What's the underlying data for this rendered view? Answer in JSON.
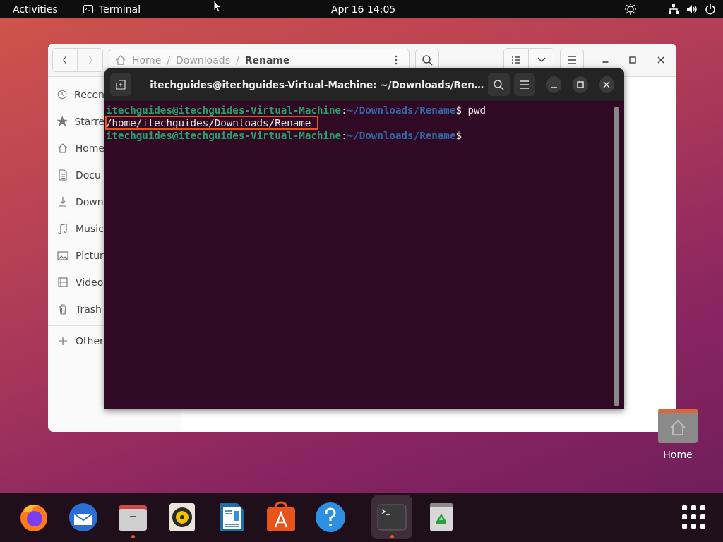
{
  "top_bar": {
    "activities": "Activities",
    "app_name": "Terminal",
    "clock": "Apr 16  14:05"
  },
  "files_window": {
    "path_bar": {
      "separator": "/",
      "items": [
        {
          "label": "Home",
          "current": false
        },
        {
          "label": "Downloads",
          "current": false
        },
        {
          "label": "Rename",
          "current": true
        }
      ]
    },
    "sidebar": {
      "items": [
        {
          "kind": "recent",
          "label": "Recen"
        },
        {
          "kind": "starred",
          "label": "Starre"
        },
        {
          "kind": "home",
          "label": "Home"
        },
        {
          "kind": "documents",
          "label": "Docu"
        },
        {
          "kind": "downloads",
          "label": "Down"
        },
        {
          "kind": "music",
          "label": "Music"
        },
        {
          "kind": "pictures",
          "label": "Pictur"
        },
        {
          "kind": "videos",
          "label": "Video"
        },
        {
          "kind": "trash",
          "label": "Trash"
        },
        {
          "kind": "other",
          "label": "Other"
        }
      ]
    }
  },
  "terminal_window": {
    "title": "itechguides@itechguides-Virtual-Machine: ~/Downloads/Ren…",
    "lines": [
      {
        "kind": "prompt",
        "user": "itechguides@itechguides-Virtual-Machine",
        "separator": ":",
        "path": "~/Downloads/Rename",
        "symbol": "$",
        "command": "pwd"
      },
      {
        "kind": "output",
        "text": "/home/itechguides/Downloads/Rename",
        "highlighted": true
      },
      {
        "kind": "prompt",
        "user": "itechguides@itechguides-Virtual-Machine",
        "separator": ":",
        "path": "~/Downloads/Rename",
        "symbol": "$"
      }
    ]
  },
  "desktop_icons": [
    {
      "label": "Home"
    }
  ],
  "dock": {
    "apps": [
      {
        "kind": "firefox",
        "running": false,
        "selected": false
      },
      {
        "kind": "thunderbird",
        "running": false,
        "selected": false
      },
      {
        "kind": "files",
        "running": true,
        "selected": false
      },
      {
        "kind": "rhythmbox",
        "running": false,
        "selected": false
      },
      {
        "kind": "writer",
        "running": false,
        "selected": false
      },
      {
        "kind": "software",
        "running": false,
        "selected": false
      },
      {
        "kind": "help",
        "running": false,
        "selected": false
      },
      {
        "kind": "terminal",
        "running": true,
        "selected": true,
        "separator_before": true
      },
      {
        "kind": "trash",
        "running": false,
        "selected": false
      }
    ]
  }
}
